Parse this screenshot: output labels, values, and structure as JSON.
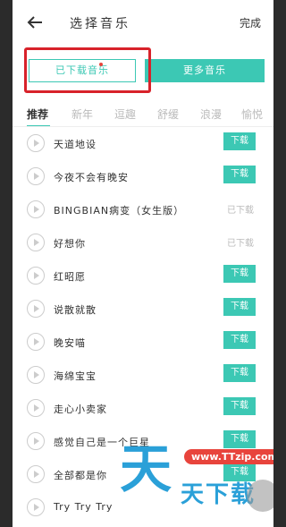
{
  "header": {
    "title": "选择音乐",
    "done_label": "完成"
  },
  "segments": {
    "downloaded_label": "已下载音乐",
    "more_label": "更多音乐"
  },
  "tabs": [
    {
      "label": "推荐",
      "active": true
    },
    {
      "label": "新年"
    },
    {
      "label": "逗趣"
    },
    {
      "label": "舒缓"
    },
    {
      "label": "浪漫"
    },
    {
      "label": "愉悦"
    }
  ],
  "songs": [
    {
      "title": "天道地设",
      "status": "下载"
    },
    {
      "title": "今夜不会有晚安",
      "status": "下载"
    },
    {
      "title": "BINGBIAN病变（女生版）",
      "status": "已下载"
    },
    {
      "title": "好想你",
      "status": "已下载"
    },
    {
      "title": "红昭愿",
      "status": "下载"
    },
    {
      "title": "说散就散",
      "status": "下载"
    },
    {
      "title": "晚安喵",
      "status": "下载"
    },
    {
      "title": "海绵宝宝",
      "status": "下载"
    },
    {
      "title": "走心小卖家",
      "status": "下载"
    },
    {
      "title": "感觉自己是一个巨星",
      "status": "下载"
    },
    {
      "title": "全部都是你",
      "status": "下载"
    },
    {
      "title": "Try Try Try",
      "status": ""
    }
  ],
  "watermark": {
    "url": "www.TTzip.com",
    "big_char": "天",
    "text": "天下载"
  }
}
